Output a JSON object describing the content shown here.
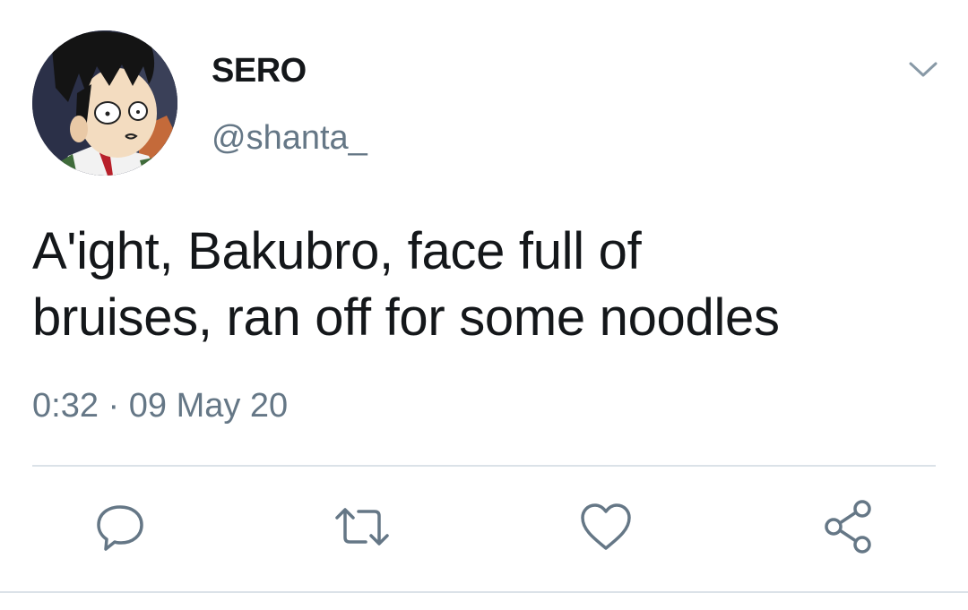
{
  "tweet": {
    "display_name": "SERO",
    "handle": "@shanta_",
    "text_line1": "A'ight, Bakubro, face full of",
    "text_line2": "bruises, ran off for some noodles",
    "time": "0:32",
    "separator": "·",
    "date": "09 May 20"
  },
  "icons": {
    "avatar": "profile-avatar",
    "menu": "chevron-down-icon",
    "reply": "reply-icon",
    "retweet": "retweet-icon",
    "like": "heart-icon",
    "share": "share-icon"
  },
  "colors": {
    "text": "#14171a",
    "secondary": "#657786",
    "divider": "#dbe2e8",
    "icon": "#657786"
  }
}
